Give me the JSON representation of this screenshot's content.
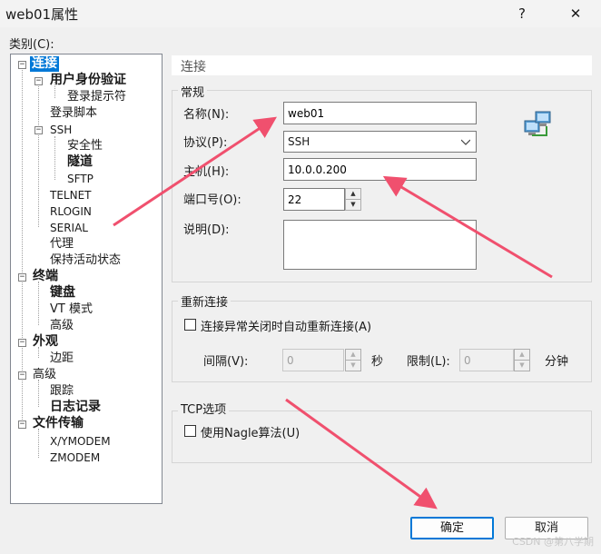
{
  "window": {
    "title": "web01属性",
    "help": "?",
    "close": "✕"
  },
  "category_label": "类别(C):",
  "tree": [
    {
      "label": "连接"
    },
    {
      "label": "用户身份验证"
    },
    {
      "label": "登录提示符"
    },
    {
      "label": "登录脚本"
    },
    {
      "label": "SSH"
    },
    {
      "label": "安全性"
    },
    {
      "label": "隧道"
    },
    {
      "label": "SFTP"
    },
    {
      "label": "TELNET"
    },
    {
      "label": "RLOGIN"
    },
    {
      "label": "SERIAL"
    },
    {
      "label": "代理"
    },
    {
      "label": "保持活动状态"
    },
    {
      "label": "终端"
    },
    {
      "label": "键盘"
    },
    {
      "label": "VT 模式"
    },
    {
      "label": "高级"
    },
    {
      "label": "外观"
    },
    {
      "label": "边距"
    },
    {
      "label": "高级"
    },
    {
      "label": "跟踪"
    },
    {
      "label": "日志记录"
    },
    {
      "label": "文件传输"
    },
    {
      "label": "X/YMODEM"
    },
    {
      "label": "ZMODEM"
    }
  ],
  "panel": {
    "header": "连接",
    "general": {
      "title": "常规",
      "name_label": "名称(N):",
      "name_value": "web01",
      "protocol_label": "协议(P):",
      "protocol_value": "SSH",
      "host_label": "主机(H):",
      "host_value": "10.0.0.200",
      "port_label": "端口号(O):",
      "port_value": "22",
      "desc_label": "说明(D):",
      "desc_value": ""
    },
    "reconnect": {
      "title": "重新连接",
      "checkbox_label": "连接异常关闭时自动重新连接(A)",
      "interval_label": "间隔(V):",
      "interval_value": "0",
      "interval_unit": "秒",
      "limit_label": "限制(L):",
      "limit_value": "0",
      "limit_unit": "分钟"
    },
    "tcp": {
      "title": "TCP选项",
      "nagle_label": "使用Nagle算法(U)"
    }
  },
  "buttons": {
    "ok": "确定",
    "cancel": "取消"
  },
  "watermark": "CSDN @第八学期",
  "colors": {
    "selection": "#0078d7",
    "arrow": "#f0506e"
  }
}
